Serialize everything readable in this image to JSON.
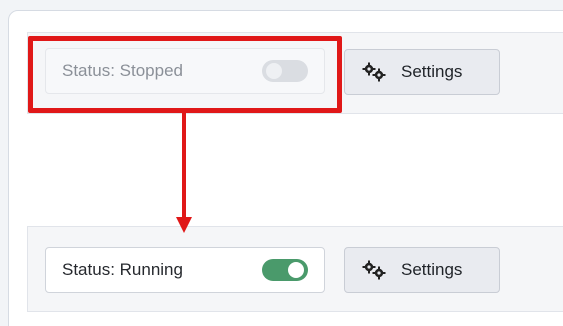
{
  "before": {
    "status_label": "Status: Stopped",
    "toggle_state": "off",
    "settings_label": "Settings",
    "settings_icon": "gears-icon"
  },
  "after": {
    "status_label": "Status: Running",
    "toggle_state": "on",
    "settings_label": "Settings",
    "settings_icon": "gears-icon"
  },
  "colors": {
    "highlight": "#e01818",
    "toggle_on": "#4a9a6b",
    "toggle_off": "#dadde2"
  }
}
